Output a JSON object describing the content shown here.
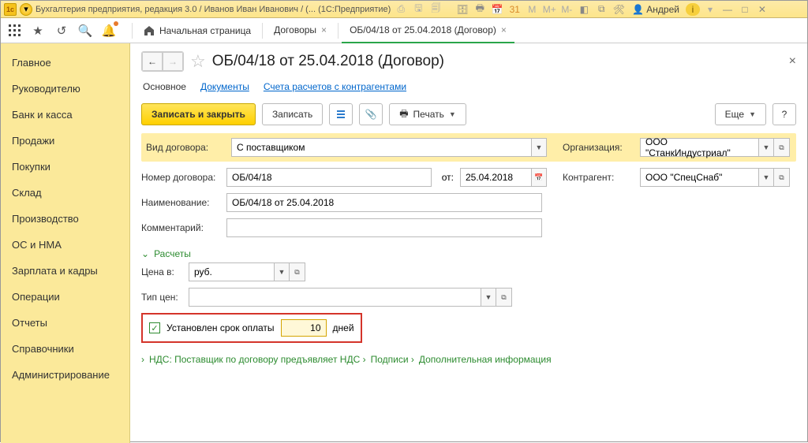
{
  "titlebar": {
    "text": "Бухгалтерия предприятия, редакция 3.0 / Иванов Иван Иванович / (...  (1С:Предприятие)",
    "user": "Андрей"
  },
  "toolbar": {
    "home_label": "Начальная страница",
    "tabs": [
      {
        "label": "Договоры",
        "active": false
      },
      {
        "label": "ОБ/04/18 от 25.04.2018 (Договор)",
        "active": true
      }
    ]
  },
  "sidebar": {
    "items": [
      "Главное",
      "Руководителю",
      "Банк и касса",
      "Продажи",
      "Покупки",
      "Склад",
      "Производство",
      "ОС и НМА",
      "Зарплата и кадры",
      "Операции",
      "Отчеты",
      "Справочники",
      "Администрирование"
    ]
  },
  "page": {
    "title": "ОБ/04/18 от 25.04.2018 (Договор)",
    "subtabs": {
      "main": "Основное",
      "docs": "Документы",
      "accounts": "Счета расчетов с контрагентами"
    },
    "actions": {
      "save_close": "Записать и закрыть",
      "save": "Записать",
      "print": "Печать",
      "more": "Еще",
      "help": "?"
    },
    "form": {
      "contract_type_label": "Вид договора:",
      "contract_type_value": "С поставщиком",
      "org_label": "Организация:",
      "org_value": "ООО \"СтанкИндустриал\"",
      "num_label": "Номер договора:",
      "num_value": "ОБ/04/18",
      "date_label": "от:",
      "date_value": "25.04.2018",
      "partner_label": "Контрагент:",
      "partner_value": "ООО \"СпецСнаб\"",
      "name_label": "Наименование:",
      "name_value": "ОБ/04/18 от 25.04.2018",
      "comment_label": "Комментарий:",
      "calc_section": "Расчеты",
      "price_label": "Цена в:",
      "price_value": "руб.",
      "price_type_label": "Тип цен:",
      "deadline_set_label": "Установлен срок оплаты",
      "deadline_value": "10",
      "days_label": "дней",
      "nds": "НДС: Поставщик по договору предъявляет НДС",
      "signatures": "Подписи",
      "extra": "Дополнительная информация"
    }
  }
}
